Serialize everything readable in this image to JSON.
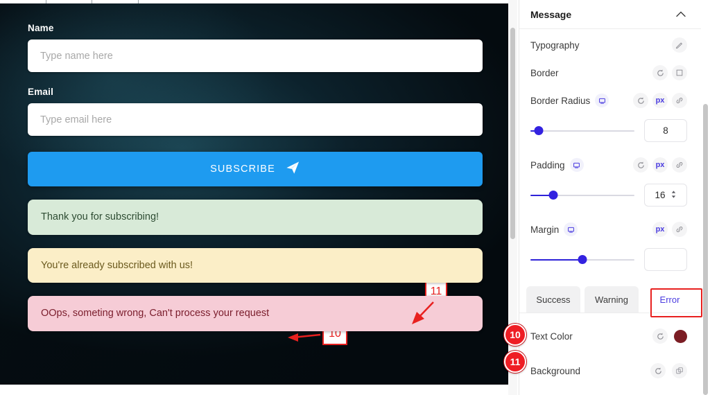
{
  "canvas": {
    "form": {
      "name_label": "Name",
      "name_placeholder": "Type name here",
      "name_value": "",
      "email_label": "Email",
      "email_placeholder": "Type email here",
      "email_value": "",
      "subscribe_label": "SUBSCRIBE",
      "subscribe_icon": "send-icon"
    },
    "alerts": {
      "success": "Thank you for subscribing!",
      "warning": "You're already subscribed with us!",
      "error": "OOps, someting wrong, Can't process your request"
    },
    "colors": {
      "button": "#1e9bf0",
      "success_bg": "#d8ead8",
      "warning_bg": "#fbeec7",
      "error_bg": "#f6ccd6",
      "error_text": "#7a1d2c"
    }
  },
  "panel": {
    "header": {
      "title": "Message",
      "collapse_icon": "chevron-up-icon"
    },
    "typography": {
      "label": "Typography",
      "edit_icon": "pencil-icon"
    },
    "border": {
      "label": "Border",
      "reset_icon": "reset-icon",
      "box_icon": "border-box-icon"
    },
    "border_radius": {
      "label": "Border Radius",
      "device_icon": "monitor-icon",
      "reset_icon": "reset-icon",
      "unit": "px",
      "link_icon": "link-icon",
      "value": "8",
      "slider_percent": 8
    },
    "padding": {
      "label": "Padding",
      "device_icon": "monitor-icon",
      "reset_icon": "reset-icon",
      "unit": "px",
      "link_icon": "link-icon",
      "value": "16",
      "slider_percent": 22,
      "stepper_icon": "stepper-arrows-icon"
    },
    "margin": {
      "label": "Margin",
      "device_icon": "monitor-icon",
      "unit": "px",
      "link_icon": "link-icon",
      "value": "",
      "slider_percent": 50
    },
    "tabs": [
      {
        "label": "Success",
        "active": false
      },
      {
        "label": "Warning",
        "active": false
      },
      {
        "label": "Error",
        "active": true
      }
    ],
    "rows": [
      {
        "label": "Text Color",
        "reset_icon": "reset-icon",
        "swatch": "#7b1d24",
        "swatch_icon": "color-swatch"
      },
      {
        "label": "Background",
        "reset_icon": "reset-icon",
        "swatch_icon": "copy-layers-icon"
      }
    ]
  },
  "annotations": {
    "marker_10": "10",
    "marker_11": "11",
    "badge_10": "10",
    "badge_11": "11",
    "color": "#e8201f"
  }
}
